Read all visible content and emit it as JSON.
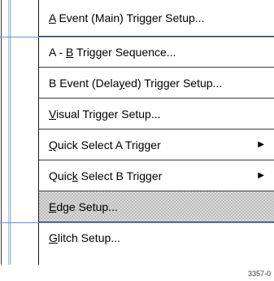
{
  "menu": {
    "items": [
      {
        "pre": "",
        "mnemonic": "A",
        "post": " Event (Main) Trigger Setup...",
        "submenu": false
      },
      {
        "pre": "A - ",
        "mnemonic": "B",
        "post": " Trigger Sequence...",
        "submenu": false
      },
      {
        "pre": "B Event (Dela",
        "mnemonic": "y",
        "post": "ed) Trigger Setup...",
        "submenu": false
      },
      {
        "pre": "",
        "mnemonic": "V",
        "post": "isual Trigger Setup...",
        "submenu": false
      },
      {
        "pre": "",
        "mnemonic": "Q",
        "post": "uick Select A Trigger",
        "submenu": true,
        "arrow": "▶"
      },
      {
        "pre": "Quic",
        "mnemonic": "k",
        "post": " Select B Trigger",
        "submenu": true,
        "arrow": "▶"
      },
      {
        "pre": "",
        "mnemonic": "E",
        "post": "dge Setup...",
        "submenu": false,
        "highlighted": true
      },
      {
        "pre": "",
        "mnemonic": "G",
        "post": "litch Setup...",
        "submenu": false
      }
    ]
  },
  "figure_id": "3357-0",
  "colors": {
    "highlight_pattern": "#bfbfbf",
    "separator_blue": "#6f8fc9",
    "gutter_light": "#a9c2e6"
  }
}
